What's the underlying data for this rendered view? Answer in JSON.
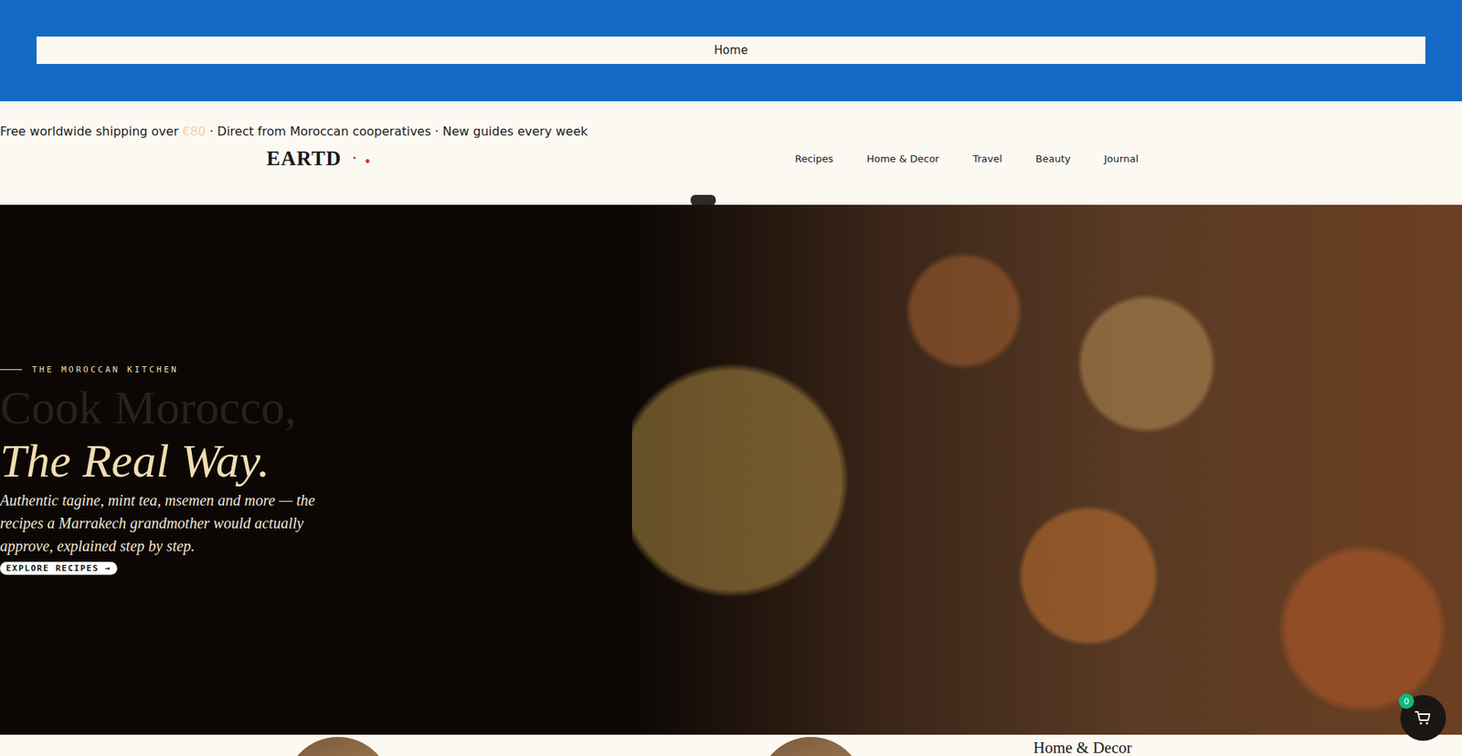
{
  "top_bar": {
    "label": "Home"
  },
  "announcement": {
    "before": "Free worldwide shipping over ",
    "highlight": "€80",
    "after": " · Direct from Moroccan cooperatives · New guides every week"
  },
  "logo": {
    "text": "EARTD",
    "marks": [
      "·",
      "•"
    ]
  },
  "nav": [
    {
      "label": "Recipes"
    },
    {
      "label": "Home & Decor"
    },
    {
      "label": "Travel"
    },
    {
      "label": "Beauty"
    },
    {
      "label": "Journal"
    }
  ],
  "hero": {
    "eyebrow": "THE MOROCCAN KITCHEN",
    "title_line1": "Cook Morocco,",
    "title_line2": "The Real Way.",
    "body": "Authentic tagine, mint tea, msemen and more — the recipes a Marrakech grandmother would actually approve, explained step by step.",
    "cta": "EXPLORE RECIPES →"
  },
  "categories": [
    {
      "kind": "image"
    },
    {
      "kind": "image"
    },
    {
      "kind": "heading",
      "title": "Home & Decor"
    }
  ],
  "cart": {
    "count": "0"
  }
}
